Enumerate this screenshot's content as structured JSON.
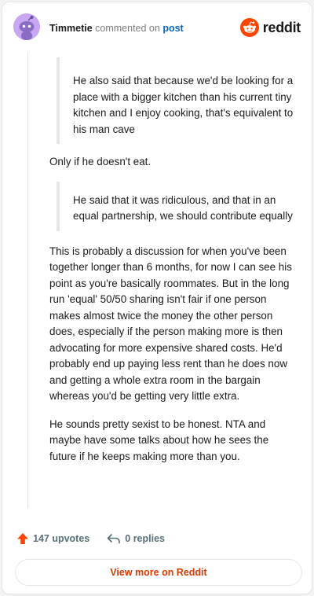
{
  "header": {
    "author": "Timmetie",
    "action_text": "commented on",
    "post_link": "post",
    "logo_text": "reddit"
  },
  "comment": {
    "quote1": "He also said that because we'd be looking for a place with a bigger kitchen than his current tiny kitchen and I enjoy cooking, that's equivalent to his man cave",
    "para1": "Only if he doesn't eat.",
    "quote2": "He said that it was ridiculous, and that in an equal partnership, we should contribute equally",
    "para2": "This is probably a discussion for when you've been together longer than 6 months, for now I can see his point as you're basically roommates. But in the long run 'equal' 50/50 sharing isn't fair if one person makes almost twice the money the other person does, especially if the person making more is then advocating for more expensive shared costs. He'd probably end up paying less rent than he does now and getting a whole extra room in the bargain whereas you'd be getting very little extra.",
    "para3": "He sounds pretty sexist to be honest. NTA and maybe have some talks about how he sees the future if he keeps making more than you."
  },
  "actions": {
    "upvotes": "147 upvotes",
    "replies": "0 replies"
  },
  "footer": {
    "view_more": "View more on Reddit"
  },
  "colors": {
    "brand": "#ff4500",
    "link": "#0a64bc",
    "view_more": "#d93a00"
  },
  "icons": [
    "snoo-avatar-icon",
    "reddit-logo-icon",
    "upvote-arrow-icon",
    "reply-arrow-icon"
  ]
}
